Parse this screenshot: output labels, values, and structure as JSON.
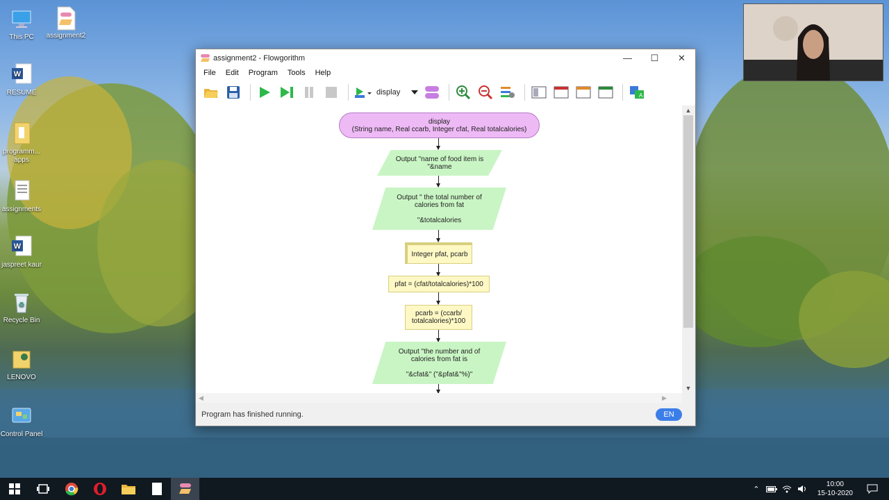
{
  "desktop": {
    "icons": [
      {
        "label": "This PC",
        "icon": "this-pc-icon"
      },
      {
        "label": "assignment2",
        "icon": "flowgorithm-file-icon"
      },
      {
        "label": "RESUME",
        "icon": "word-document-icon"
      },
      {
        "label": "programm... apps",
        "icon": "folder-icon"
      },
      {
        "label": "assignments",
        "icon": "document-icon"
      },
      {
        "label": "jaspreet kaur",
        "icon": "word-document-icon"
      },
      {
        "label": "Recycle Bin",
        "icon": "recycle-bin-icon"
      },
      {
        "label": "LENOVO",
        "icon": "folder-icon"
      },
      {
        "label": "Control Panel",
        "icon": "control-panel-icon"
      }
    ]
  },
  "window": {
    "title": "assignment2 - Flowgorithm",
    "menu": [
      "File",
      "Edit",
      "Program",
      "Tools",
      "Help"
    ],
    "function_select": "display",
    "status": "Program has finished running.",
    "language": "EN"
  },
  "flowchart": {
    "header": "display\n(String name, Real ccarb, Integer cfat, Real totalcalories)",
    "output1": "Output \"name of food item is\n\"&name",
    "output2": "Output \" the total number of\ncalories from fat\n\n\"&totalcalories",
    "declare": "Integer pfat, pcarb",
    "assign1": "pfat = (cfat/totalcalories)*100",
    "assign2": "pcarb = (ccarb/\ntotalcalories)*100",
    "output3": "Output \"the number and of\ncalories from fat is\n\n\"&cfat&\" (\"&pfat&\"%)\""
  },
  "colors": {
    "oval_fill": "#eebaf6",
    "output_fill": "#c9f5c4",
    "process_fill": "#fdf8c4",
    "language_pill": "#3c7ee8"
  },
  "taskbar": {
    "time": "10:00",
    "date": "15-10-2020"
  }
}
